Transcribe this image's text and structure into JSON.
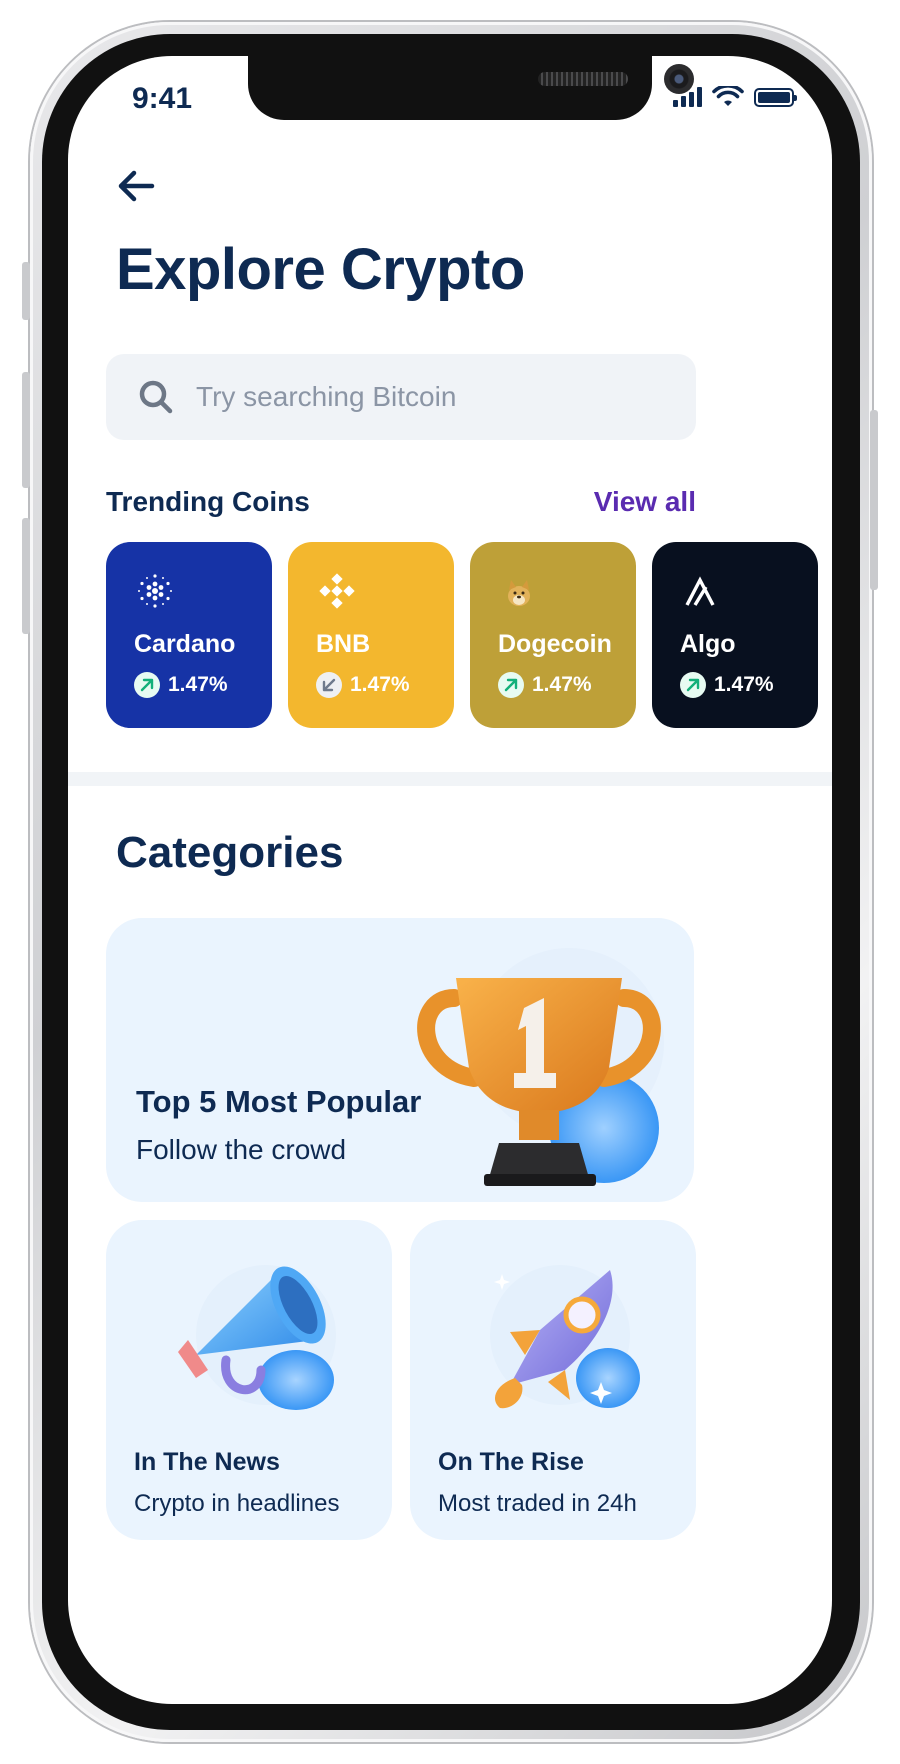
{
  "status_bar": {
    "time": "9:41"
  },
  "page": {
    "title": "Explore Crypto"
  },
  "search": {
    "placeholder": "Try searching Bitcoin"
  },
  "trending": {
    "title": "Trending Coins",
    "view_all": "View all",
    "coins": [
      {
        "name": "Cardano",
        "change": "1.47%",
        "direction": "up",
        "color": "#1633a6",
        "icon": "cardano-icon"
      },
      {
        "name": "BNB",
        "change": "1.47%",
        "direction": "down",
        "color": "#f3b72e",
        "icon": "bnb-icon"
      },
      {
        "name": "Dogecoin",
        "change": "1.47%",
        "direction": "up",
        "color": "#bea038",
        "icon": "dogecoin-icon"
      },
      {
        "name": "Algo",
        "change": "1.47%",
        "direction": "up",
        "color": "#08101f",
        "icon": "algorand-icon"
      }
    ]
  },
  "categories": {
    "title": "Categories",
    "items": [
      {
        "name": "Top 5 Most Popular",
        "subtitle": "Follow the crowd",
        "icon": "trophy-icon"
      },
      {
        "name": "In The News",
        "subtitle": "Crypto in headlines",
        "icon": "megaphone-icon"
      },
      {
        "name": "On The Rise",
        "subtitle": "Most traded in 24h",
        "icon": "rocket-icon"
      }
    ]
  },
  "colors": {
    "primary_text": "#0e2a52",
    "accent": "#5a2bb0",
    "card_bg": "#eaf4fe"
  }
}
